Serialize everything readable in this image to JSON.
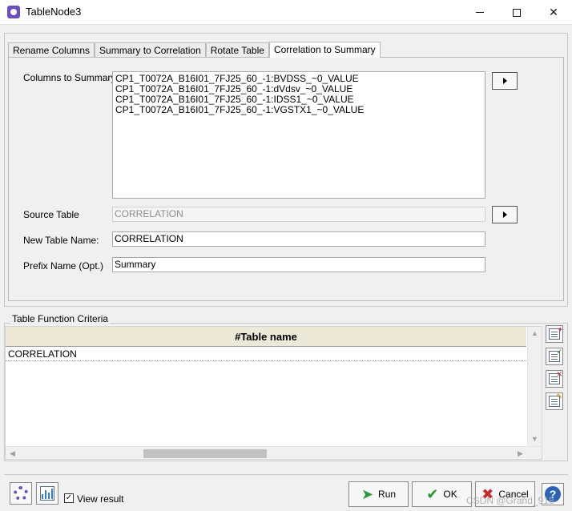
{
  "window": {
    "title": "TableNode3",
    "minimize_glyph": "–",
    "maximize_glyph": "☐",
    "close_glyph": "✕"
  },
  "tabs": [
    {
      "label": "Rename Columns"
    },
    {
      "label": "Summary to Correlation"
    },
    {
      "label": "Rotate Table"
    },
    {
      "label": "Correlation to Summary",
      "active": true
    }
  ],
  "form": {
    "columns_label": "Columns to Summary",
    "columns": [
      "CP1_T0072A_B16I01_7FJ25_60_-1:BVDSS_~0_VALUE",
      "CP1_T0072A_B16I01_7FJ25_60_-1:dVdsv_~0_VALUE",
      "CP1_T0072A_B16I01_7FJ25_60_-1:IDSS1_~0_VALUE",
      "CP1_T0072A_B16I01_7FJ25_60_-1:VGSTX1_~0_VALUE"
    ],
    "source_label": "Source Table",
    "source_value": "CORRELATION",
    "new_table_label": "New Table Name:",
    "new_table_value": "CORRELATION",
    "prefix_label": "Prefix Name (Opt.)",
    "prefix_value": "Summary"
  },
  "criteria": {
    "title": "Table Function Criteria",
    "header": "#Table name",
    "rows": [
      "CORRELATION"
    ],
    "scroll_glyphs": {
      "up": "▲",
      "down": "▼",
      "left": "◀",
      "right": "▶"
    },
    "side_icons": [
      "add-row-icon",
      "edit-row-icon",
      "delete-row-icon",
      "clear-icon"
    ],
    "side_badges": [
      "+",
      "✓",
      "✕",
      "✎"
    ]
  },
  "footer": {
    "view_result_label": "View result",
    "view_result_checked": true,
    "check_glyph": "✓",
    "run_label": "Run",
    "run_glyph": "➤",
    "ok_label": "OK",
    "ok_glyph": "✔",
    "cancel_label": "Cancel",
    "cancel_glyph": "✖",
    "help_glyph": "?",
    "watermark": "CSDN @Grand_918"
  },
  "colors": {
    "accent": "#6a4fc2",
    "run_green": "#2a9a3a",
    "ok_green": "#1f9b2c",
    "cancel_red": "#c62828",
    "help_blue": "#2c62b8"
  }
}
